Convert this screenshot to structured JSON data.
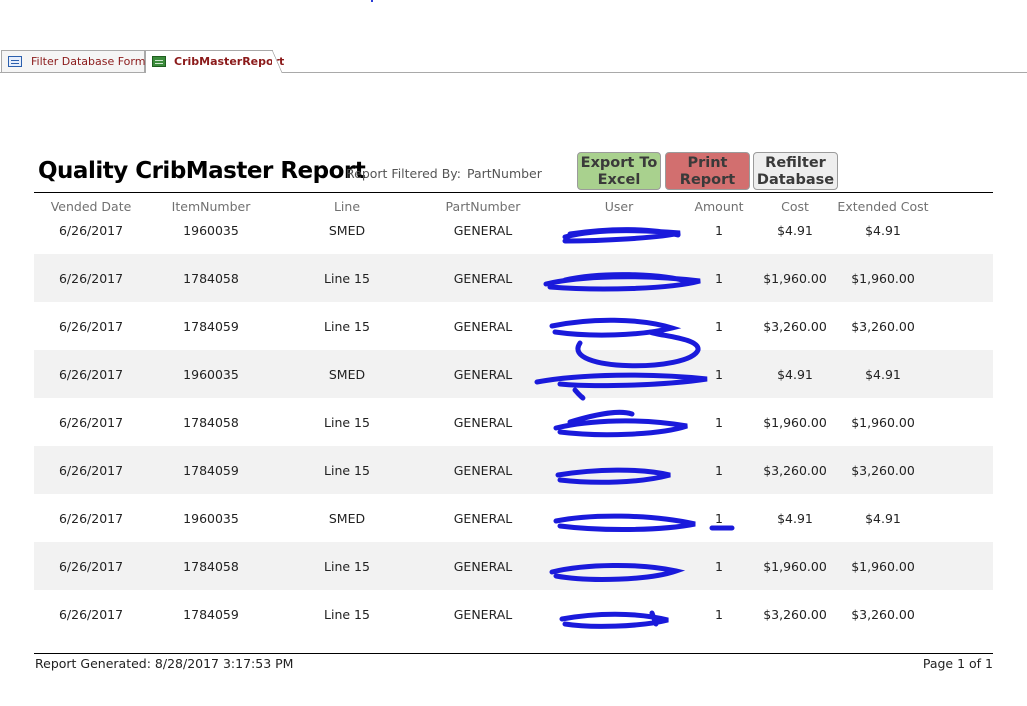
{
  "tabs": [
    {
      "label": "Filter Database Form",
      "icon": "form-icon"
    },
    {
      "label": "CribMasterReport",
      "icon": "report-icon",
      "active": true
    }
  ],
  "report": {
    "title": "Quality CribMaster Report",
    "filter_label": "Report Filtered By:",
    "filter_value": "PartNumber"
  },
  "buttons": {
    "export": [
      "Export To",
      "Excel"
    ],
    "print": [
      "Print",
      "Report"
    ],
    "refilter": [
      "Refilter",
      "Database"
    ]
  },
  "columns": [
    "Vended Date",
    "ItemNumber",
    "Line",
    "PartNumber",
    "User",
    "Amount",
    "Cost",
    "Extended Cost"
  ],
  "rows": [
    {
      "date": "6/26/2017",
      "item": "1960035",
      "line": "SMED",
      "part": "GENERAL",
      "amount": "1",
      "cost": "$4.91",
      "ext": "$4.91"
    },
    {
      "date": "6/26/2017",
      "item": "1784058",
      "line": "Line 15",
      "part": "GENERAL",
      "amount": "1",
      "cost": "$1,960.00",
      "ext": "$1,960.00"
    },
    {
      "date": "6/26/2017",
      "item": "1784059",
      "line": "Line 15",
      "part": "GENERAL",
      "amount": "1",
      "cost": "$3,260.00",
      "ext": "$3,260.00"
    },
    {
      "date": "6/26/2017",
      "item": "1960035",
      "line": "SMED",
      "part": "GENERAL",
      "amount": "1",
      "cost": "$4.91",
      "ext": "$4.91"
    },
    {
      "date": "6/26/2017",
      "item": "1784058",
      "line": "Line 15",
      "part": "GENERAL",
      "amount": "1",
      "cost": "$1,960.00",
      "ext": "$1,960.00"
    },
    {
      "date": "6/26/2017",
      "item": "1784059",
      "line": "Line 15",
      "part": "GENERAL",
      "amount": "1",
      "cost": "$3,260.00",
      "ext": "$3,260.00"
    },
    {
      "date": "6/26/2017",
      "item": "1960035",
      "line": "SMED",
      "part": "GENERAL",
      "amount": "1",
      "cost": "$4.91",
      "ext": "$4.91"
    },
    {
      "date": "6/26/2017",
      "item": "1784058",
      "line": "Line 15",
      "part": "GENERAL",
      "amount": "1",
      "cost": "$1,960.00",
      "ext": "$1,960.00"
    },
    {
      "date": "6/26/2017",
      "item": "1784059",
      "line": "Line 15",
      "part": "GENERAL",
      "amount": "1",
      "cost": "$3,260.00",
      "ext": "$3,260.00"
    }
  ],
  "footer": {
    "generated": "Report Generated: 8/28/2017 3:17:53 PM",
    "page": "Page 1 of 1"
  },
  "colors": {
    "excel_button": "#a9d18e",
    "print_button": "#d26f6f",
    "refilter_button": "#eeeeee",
    "redaction_scribble": "#1a1adb",
    "tab_text": "#8b1a1a"
  }
}
